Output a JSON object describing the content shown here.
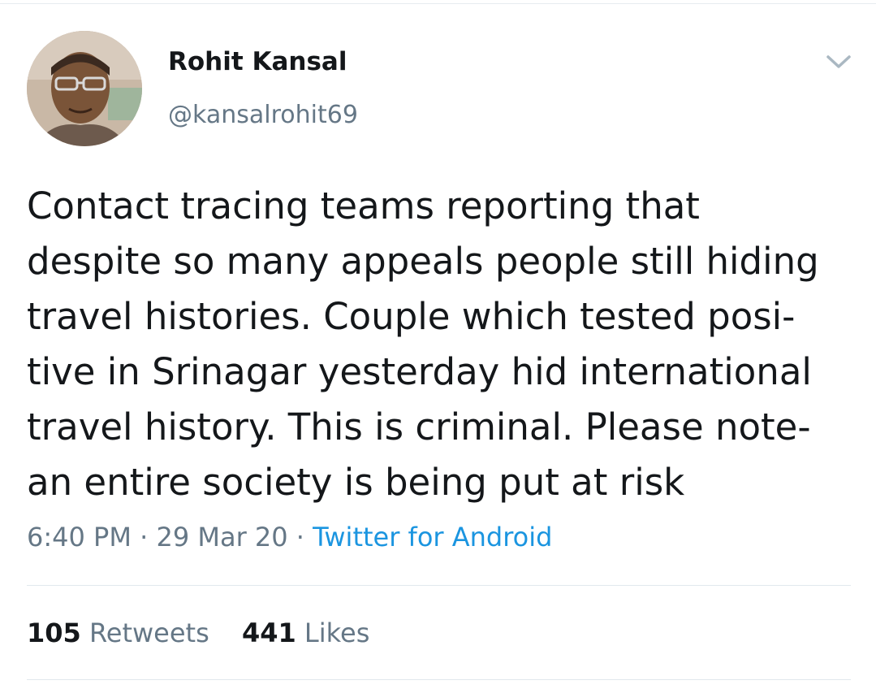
{
  "tweet": {
    "author": {
      "display_name": "Rohit Kansal",
      "handle": "@kansalrohit69"
    },
    "text_lines": [
      "Contact tracing teams reporting that",
      "despite so many appeals people still hiding",
      "travel histories. Couple which tested posi-",
      "tive in Srinagar yesterday hid international",
      "travel history. This is criminal. Please note-",
      "an entire society is being put at risk"
    ],
    "time": "6:40 PM",
    "separator": "·",
    "date": "29 Mar 20",
    "source": "Twitter for Android",
    "retweets": {
      "count": "105",
      "label": "Retweets"
    },
    "likes": {
      "count": "441",
      "label": "Likes"
    }
  },
  "colors": {
    "text_primary": "#14171a",
    "text_secondary": "#657786",
    "link": "#1b95e0",
    "divider": "#e1e8ed"
  },
  "icons": {
    "menu": "chevron-down-icon"
  }
}
